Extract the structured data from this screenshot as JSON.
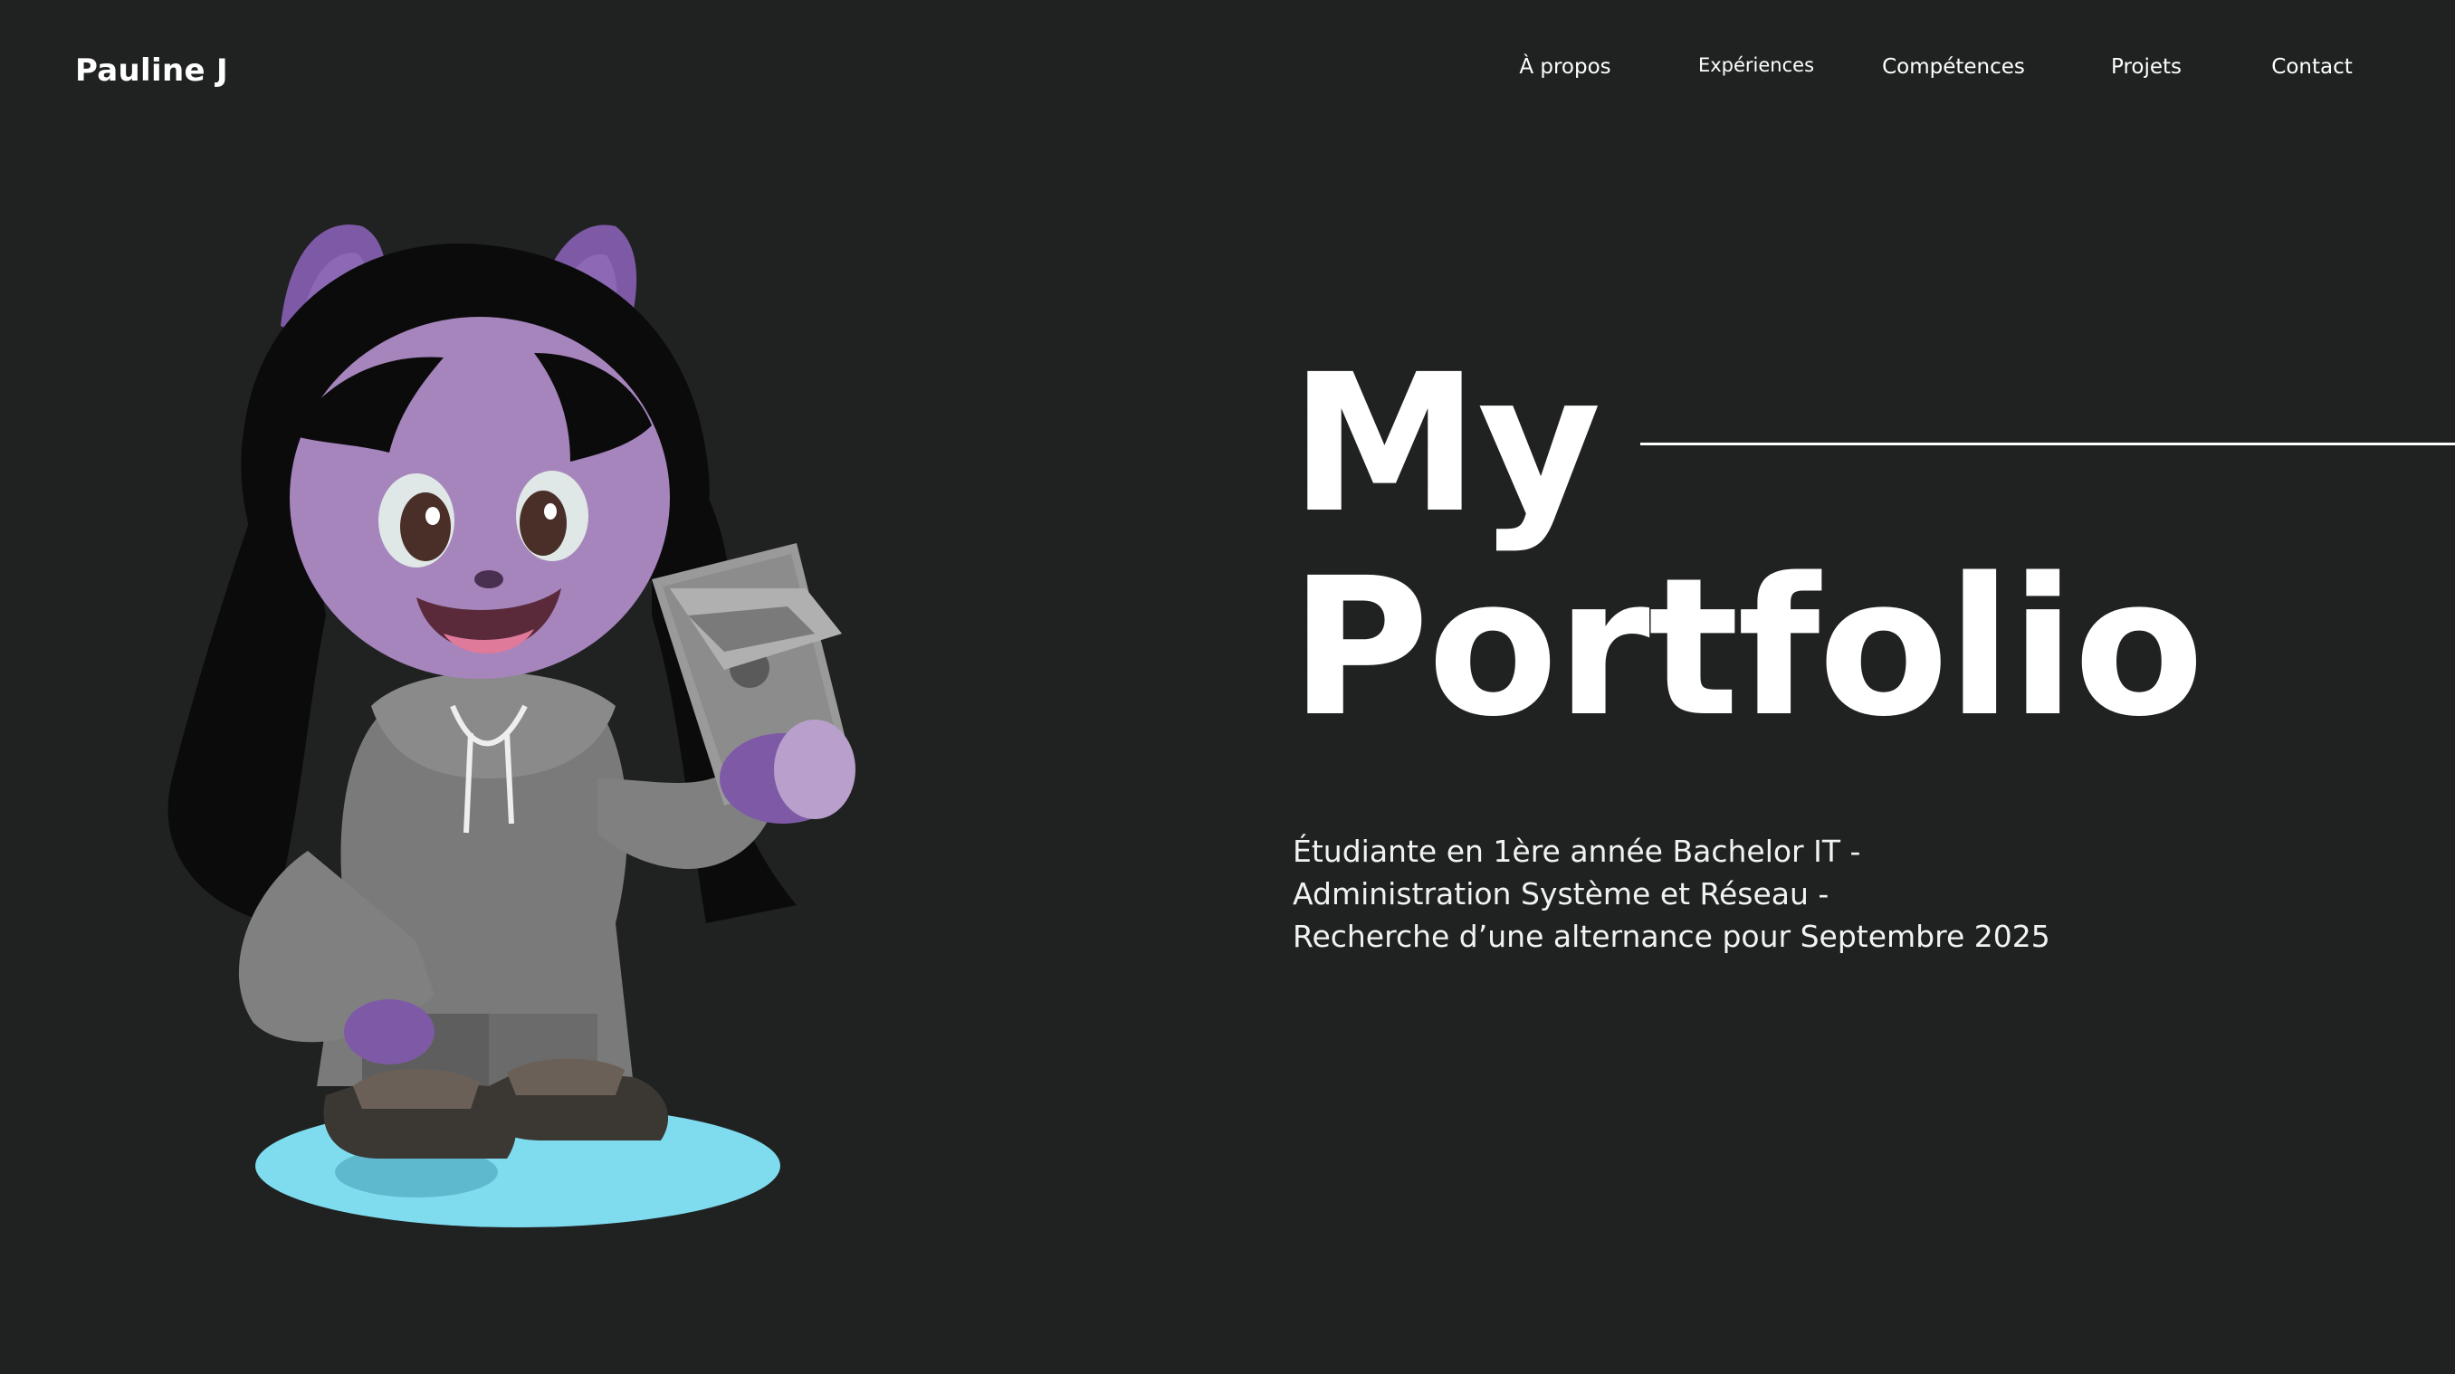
{
  "header": {
    "brand": "Pauline J",
    "nav": [
      {
        "label": "À propos"
      },
      {
        "label": "Expériences"
      },
      {
        "label": "Compétences"
      },
      {
        "label": "Projets"
      },
      {
        "label": "Contact"
      }
    ]
  },
  "hero": {
    "title_line1": "My",
    "title_line2": "Portfolio",
    "subtitle_lines": [
      "Étudiante en 1ère année Bachelor IT -",
      "Administration Système et Réseau -",
      "Recherche d’une alternance pour Septembre 2025"
    ]
  },
  "illustration": {
    "icon": "octocat-mascot-with-laptop-icon"
  },
  "colors": {
    "background": "#202222",
    "text": "#ffffff",
    "mascot_skin": "#a684bc",
    "mascot_ears": "#7e5aa6",
    "hoodie": "#7d7d7d",
    "shadow_ellipse": "#7fdcef"
  }
}
